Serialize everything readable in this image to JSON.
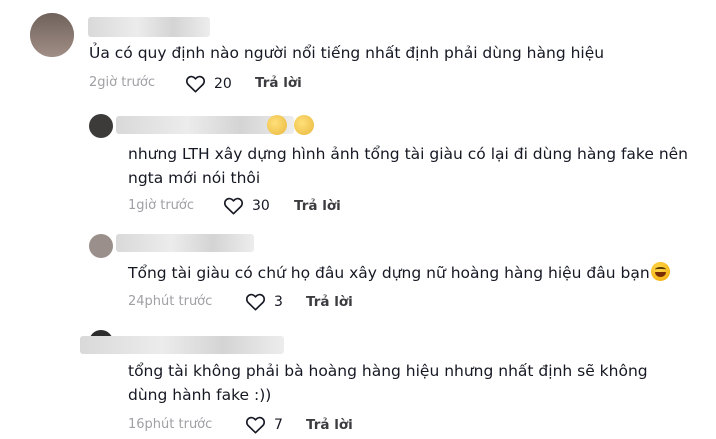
{
  "comments": [
    {
      "text": "Ủa có quy định nào người nổi tiếng nhất định phải dùng hàng hiệu",
      "time": "2giờ trước",
      "likes": "20",
      "reply": "Trả lời"
    },
    {
      "text": "nhưng LTH xây dựng hình ảnh tổng tài giàu có lại đi dùng hàng fake nên\nngta mới nói thôi",
      "time": "1giờ trước",
      "likes": "30",
      "reply": "Trả lời"
    },
    {
      "text": "Tổng tài giàu có chứ họ đâu xây dựng nữ hoàng hàng hiệu đâu bạn",
      "time": "24phút trước",
      "likes": "3",
      "reply": "Trả lời"
    },
    {
      "text": "tổng tài không phải bà hoàng hàng hiệu nhưng nhất định sẽ không\ndùng hành fake :))",
      "time": "16phút trước",
      "likes": "7",
      "reply": "Trả lời"
    }
  ],
  "icons": {
    "like": "heart-outline-icon",
    "emoji": "laughing-emoji-icon"
  }
}
